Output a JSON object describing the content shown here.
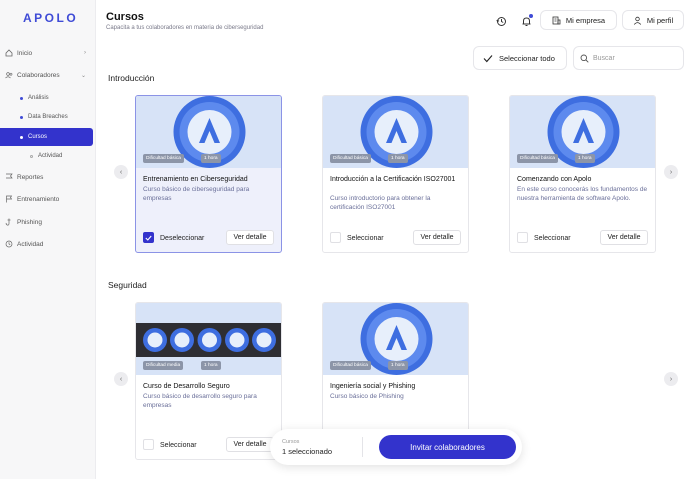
{
  "sidebar": {
    "logo": "APOLO",
    "items": [
      {
        "label": "Inicio"
      },
      {
        "label": "Colaboradores"
      },
      {
        "label": "Análisis"
      },
      {
        "label": "Data Breaches"
      },
      {
        "label": "Cursos"
      },
      {
        "label": "Actividad"
      },
      {
        "label": "Reportes"
      },
      {
        "label": "Entrenamiento"
      },
      {
        "label": "Phishing"
      },
      {
        "label": "Actividad"
      }
    ]
  },
  "header": {
    "title": "Cursos",
    "subtitle": "Capacita a tus colaboradores en materia de ciberseguridad",
    "company_label": "Mi empresa",
    "profile_label": "Mi perfil"
  },
  "toolbar": {
    "select_all_label": "Seleccionar todo",
    "search_placeholder": "Buscar"
  },
  "sections": [
    {
      "title": "Introducción",
      "cards": [
        {
          "badge_difficulty": "Dificultad básica",
          "badge_time": "1 hora",
          "title": "Entrenamiento en Ciberseguridad",
          "description": "Curso básico de ciberseguridad para empresas",
          "select_label": "Deseleccionar",
          "detail_label": "Ver detalle",
          "selected": true
        },
        {
          "badge_difficulty": "Dificultad básica",
          "badge_time": "1 hora",
          "title": "Introducción a la Certificación ISO27001",
          "description": "Curso introductorio para obtener la certificación ISO27001",
          "select_label": "Seleccionar",
          "detail_label": "Ver detalle",
          "selected": false
        },
        {
          "badge_difficulty": "Dificultad básica",
          "badge_time": "1 hora",
          "title": "Comenzando con Apolo",
          "description": "En este curso conocerás los fundamentos de nuestra herramienta de software Apolo.",
          "select_label": "Seleccionar",
          "detail_label": "Ver detalle",
          "selected": false
        }
      ]
    },
    {
      "title": "Seguridad",
      "cards": [
        {
          "badge_difficulty": "Dificultad media",
          "badge_time": "1 hora",
          "title": "Curso de Desarrollo Seguro",
          "description": "Curso básico de desarrollo seguro para empresas",
          "select_label": "Seleccionar",
          "detail_label": "Ver detalle",
          "selected": false
        },
        {
          "badge_difficulty": "Dificultad básica",
          "badge_time": "1 hora",
          "title": "Ingeniería social y Phishing",
          "description": "Curso básico de Phishing",
          "select_label": "",
          "detail_label": "",
          "selected": false
        }
      ]
    }
  ],
  "floating_bar": {
    "label": "Cursos",
    "value": "1 seleccionado",
    "button_label": "Invitar colaboradores"
  },
  "colors": {
    "accent": "#3333cc",
    "logo": "#3f4bd6",
    "banner": "#d7e3f7"
  },
  "icons": [
    "home-icon",
    "users-icon",
    "flag-icon",
    "training-flag-icon",
    "hook-icon",
    "history-icon",
    "bell-icon",
    "building-icon",
    "user-icon",
    "check-icon",
    "search-icon",
    "chevron-left-icon",
    "chevron-right-icon"
  ]
}
